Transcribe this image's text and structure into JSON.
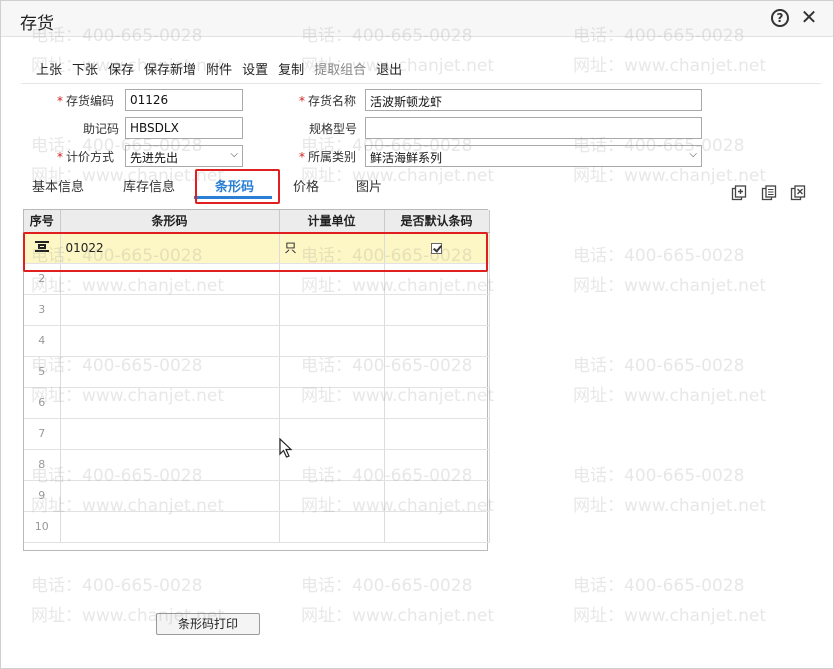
{
  "window": {
    "title": "存货"
  },
  "toolbar": [
    {
      "label": "上张",
      "disabled": false
    },
    {
      "label": "下张",
      "disabled": false
    },
    {
      "label": "保存",
      "disabled": false
    },
    {
      "label": "保存新增",
      "disabled": false
    },
    {
      "label": "附件",
      "disabled": false
    },
    {
      "label": "设置",
      "disabled": false
    },
    {
      "label": "复制",
      "disabled": false
    },
    {
      "label": "提取组合",
      "disabled": true
    },
    {
      "label": "退出",
      "disabled": false
    }
  ],
  "form": {
    "code_label": "存货编码",
    "code_value": "01126",
    "name_label": "存货名称",
    "name_value": "活波斯顿龙虾",
    "mnemonic_label": "助记码",
    "mnemonic_value": "HBSDLX",
    "spec_label": "规格型号",
    "spec_value": "",
    "pricing_label": "计价方式",
    "pricing_value": "先进先出",
    "category_label": "所属类别",
    "category_value": "鲜活海鲜系列"
  },
  "tabs": [
    {
      "label": "基本信息",
      "active": false
    },
    {
      "label": "库存信息",
      "active": false
    },
    {
      "label": "条形码",
      "active": true
    },
    {
      "label": "价格",
      "active": false
    },
    {
      "label": "图片",
      "active": false
    }
  ],
  "icons": {
    "add": "add-row-icon",
    "copy": "copy-row-icon",
    "delete": "delete-row-icon"
  },
  "grid": {
    "headers": [
      "序号",
      "条形码",
      "计量单位",
      "是否默认条码"
    ],
    "rows": [
      {
        "num": "",
        "barcode": "01022",
        "unit": "只",
        "default": true
      },
      {
        "num": "2",
        "barcode": "",
        "unit": "",
        "default": false
      },
      {
        "num": "3",
        "barcode": "",
        "unit": "",
        "default": false
      },
      {
        "num": "4",
        "barcode": "",
        "unit": "",
        "default": false
      },
      {
        "num": "5",
        "barcode": "",
        "unit": "",
        "default": false
      },
      {
        "num": "6",
        "barcode": "",
        "unit": "",
        "default": false
      },
      {
        "num": "7",
        "barcode": "",
        "unit": "",
        "default": false
      },
      {
        "num": "8",
        "barcode": "",
        "unit": "",
        "default": false
      },
      {
        "num": "9",
        "barcode": "",
        "unit": "",
        "default": false
      },
      {
        "num": "10",
        "barcode": "",
        "unit": "",
        "default": false
      }
    ]
  },
  "print_button": "条形码打印",
  "watermark": {
    "phone": "电话：400-665-0028",
    "site": "网址：www.chanjet.net"
  },
  "colors": {
    "accent": "#2a7fd4",
    "highlight": "#e02020",
    "selected_row": "#fdf7c6"
  }
}
